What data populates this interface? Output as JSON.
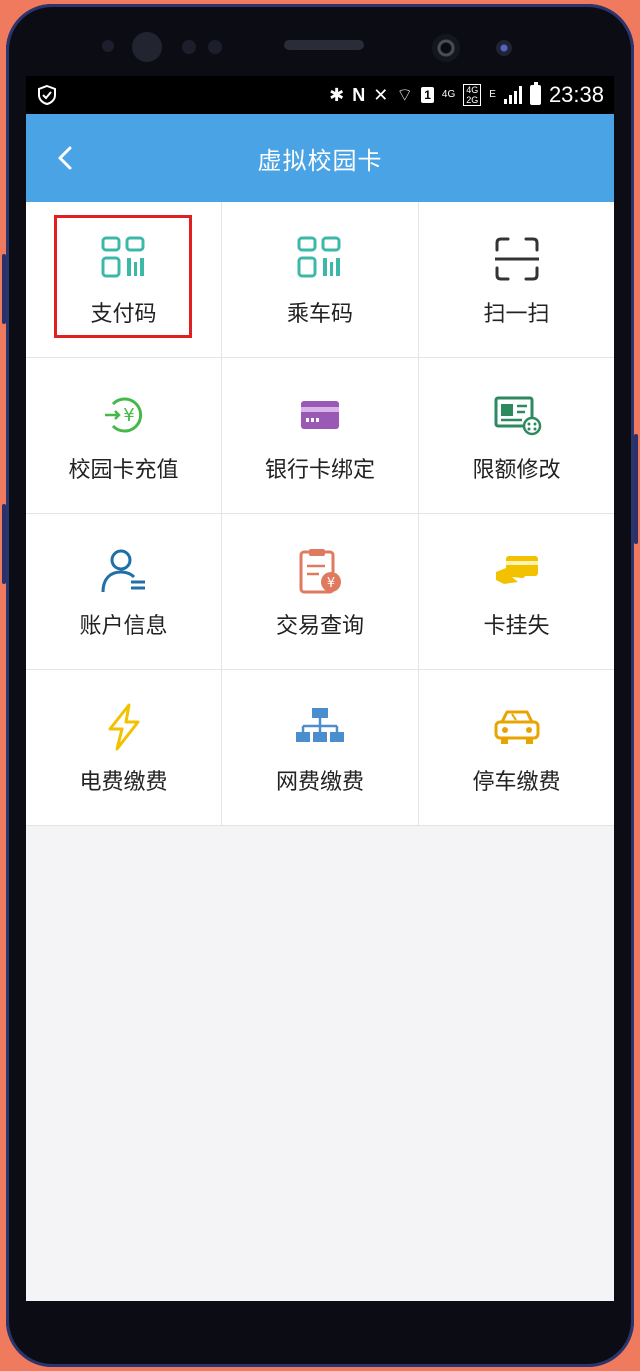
{
  "status_bar": {
    "time": "23:38",
    "network_1": "4G",
    "network_2_top": "4G",
    "network_2_bottom": "2G",
    "edge": "E",
    "sim_badge": "1"
  },
  "header": {
    "title": "虚拟校园卡"
  },
  "accent_color": "#4aa3e4",
  "grid_items": [
    {
      "label": "支付码",
      "icon": "qr-code-icon",
      "color": "#3cb8a8",
      "highlighted": true
    },
    {
      "label": "乘车码",
      "icon": "qr-code-icon",
      "color": "#3cb8a8"
    },
    {
      "label": "扫一扫",
      "icon": "scan-icon",
      "color": "#333333"
    },
    {
      "label": "校园卡充值",
      "icon": "recharge-yen-icon",
      "color": "#46b84a"
    },
    {
      "label": "银行卡绑定",
      "icon": "bank-card-icon",
      "color": "#9b59b6"
    },
    {
      "label": "限额修改",
      "icon": "id-card-icon",
      "color": "#2c8a5e"
    },
    {
      "label": "账户信息",
      "icon": "user-account-icon",
      "color": "#1f6fa8"
    },
    {
      "label": "交易查询",
      "icon": "transaction-clipboard-icon",
      "color": "#e07a5f"
    },
    {
      "label": "卡挂失",
      "icon": "hand-card-icon",
      "color": "#f2c200"
    },
    {
      "label": "电费缴费",
      "icon": "lightning-icon",
      "color": "#f2c200"
    },
    {
      "label": "网费缴费",
      "icon": "network-tree-icon",
      "color": "#4a8ed0"
    },
    {
      "label": "停车缴费",
      "icon": "car-icon",
      "color": "#e8a400"
    }
  ]
}
